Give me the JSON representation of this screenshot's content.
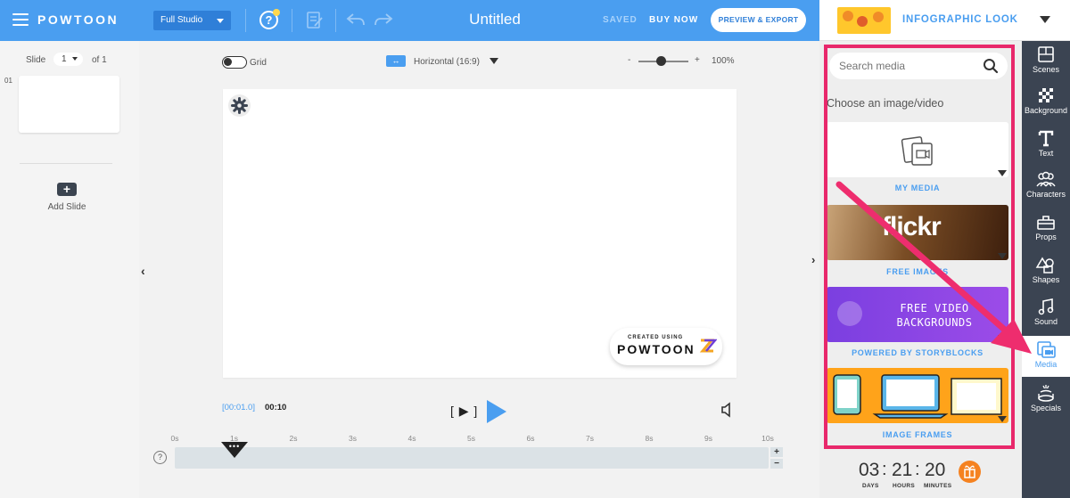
{
  "topbar": {
    "logo": "POWTOON",
    "studio_mode": "Full Studio",
    "help_label": "?",
    "title": "Untitled",
    "saved": "SAVED",
    "buy_now": "BUY NOW",
    "preview_export": "PREVIEW & EXPORT"
  },
  "look": {
    "label": "INFOGRAPHIC LOOK"
  },
  "slides": {
    "label": "Slide",
    "current": "1",
    "of": "of 1",
    "items": [
      {
        "index": "01"
      }
    ],
    "add_label": "Add Slide",
    "add_icon": "+"
  },
  "canvas_controls": {
    "grid_label": "Grid",
    "ratio_icon": "↔",
    "ratio": "Horizontal (16:9)",
    "zoom_minus": "-",
    "zoom_plus": "+",
    "zoom": "100%",
    "zoom_level": 0.45
  },
  "watermark": {
    "small": "CREATED USING",
    "big": "POWTOON"
  },
  "player": {
    "current_time": "[00:01.0]",
    "total_time": "00:10",
    "frame_button": "[ ▶ ]"
  },
  "timeline": {
    "ticks": [
      "0s",
      "1s",
      "2s",
      "3s",
      "4s",
      "5s",
      "6s",
      "7s",
      "8s",
      "9s",
      "10s"
    ],
    "playhead_label": "•••",
    "help": "?",
    "zoom_in": "+",
    "zoom_out": "−"
  },
  "nav": {
    "left": "‹",
    "right": "›"
  },
  "media": {
    "search_placeholder": "Search media",
    "choose_label": "Choose an image/video",
    "cards": [
      {
        "label": "MY MEDIA"
      },
      {
        "label": "FREE IMAGES",
        "banner": "flickr"
      },
      {
        "label": "POWERED BY STORYBLOCKS",
        "banner": "FREE VIDEO\nBACKGROUNDS"
      },
      {
        "label": "IMAGE FRAMES"
      }
    ]
  },
  "countdown": {
    "days": "03",
    "hours": "21",
    "minutes": "20",
    "days_label": "DAYS",
    "hours_label": "HOURS",
    "minutes_label": "MINUTES"
  },
  "tools": [
    {
      "label": "Scenes",
      "icon": "scenes-icon"
    },
    {
      "label": "Background",
      "icon": "background-icon"
    },
    {
      "label": "Text",
      "icon": "text-icon"
    },
    {
      "label": "Characters",
      "icon": "characters-icon"
    },
    {
      "label": "Props",
      "icon": "props-icon"
    },
    {
      "label": "Shapes",
      "icon": "shapes-icon"
    },
    {
      "label": "Sound",
      "icon": "sound-icon"
    },
    {
      "label": "Media",
      "icon": "media-icon",
      "active": true
    },
    {
      "label": "Specials",
      "icon": "specials-icon"
    }
  ],
  "colors": {
    "brand": "#4a9ef0",
    "highlight": "#e8286b",
    "sidebar": "#3b4452"
  }
}
